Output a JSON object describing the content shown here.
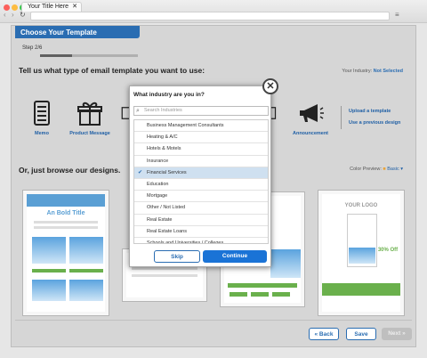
{
  "browser": {
    "tab_title": "Your Title Here",
    "address": "",
    "traffic_colors": [
      "#fc605c",
      "#fdbc40",
      "#34c84a"
    ]
  },
  "wizard": {
    "header": "Choose Your Template",
    "step_label": "Step 2/6",
    "progress": 0.33,
    "question": "Tell us what type of email template you want to use:",
    "industry_label": "Your Industry:",
    "industry_value": "Not Selected",
    "categories": [
      {
        "label": "Memo",
        "icon": "memo-icon"
      },
      {
        "label": "Product Message",
        "icon": "gift-icon"
      },
      {
        "label": "",
        "icon": "partial-icon"
      },
      {
        "label": "",
        "icon": "partial-icon-right"
      },
      {
        "label": "Announcement",
        "icon": "megaphone-icon"
      }
    ],
    "links": [
      "Upload a template",
      "Use a previous design"
    ],
    "browse_title": "Or, just browse our designs.",
    "color_preview_label": "Color Preview:",
    "color_preview_value": "Basic",
    "templates": [
      {
        "title": "An Bold Title",
        "accent": "#5a9fd4"
      },
      {
        "title": "",
        "accent": "#cccccc"
      },
      {
        "title": "",
        "accent": "#6ab04c"
      },
      {
        "title": "YOUR LOGO",
        "promo": "30% Off",
        "accent": "#6ab04c"
      }
    ],
    "back_label": "« Back",
    "save_label": "Save",
    "next_label": "Next »"
  },
  "modal": {
    "title": "What industry are you in?",
    "search_placeholder": "Search Industries",
    "items": [
      "Business Management Consultants",
      "Heating & A/C",
      "Hotels & Motels",
      "Insurance",
      "Financial Services",
      "Education",
      "Mortgage",
      "Other / Not Listed",
      "Real Estate",
      "Real Estate Loans",
      "Schools and Universities / Colleges"
    ],
    "selected_index": 4,
    "skip_label": "Skip",
    "continue_label": "Continue"
  }
}
